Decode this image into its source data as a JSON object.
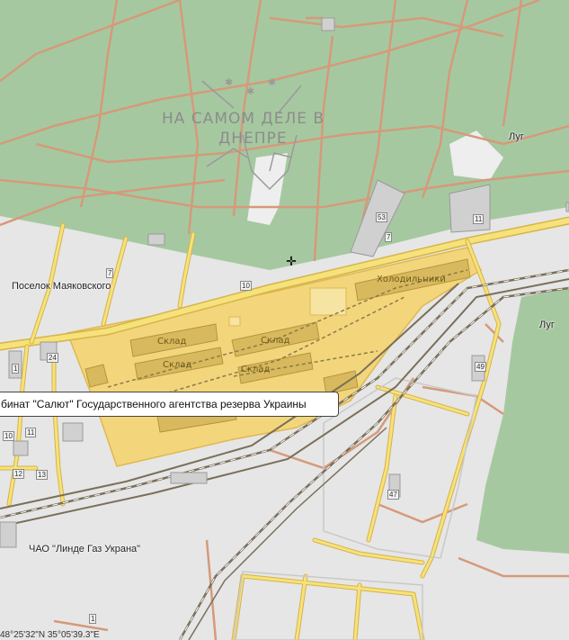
{
  "watermark": {
    "line1": "НА САМОМ ДЕЛЕ В",
    "line2": "ДНЕПРЕ"
  },
  "place_labels": {
    "poselok": "Поселок Маяковского",
    "lug_top": "Луг",
    "lug_right": "Луг",
    "linde": "ЧАО \"Линде Газ Украна\""
  },
  "buildings": {
    "holodilniki": "Холодильники",
    "sklad1": "Склад",
    "sklad2": "Склад",
    "sklad3": "Склад",
    "sklad4": "Склад"
  },
  "house_numbers": {
    "n7a": "7",
    "n10": "10",
    "n53": "53",
    "n7b": "7",
    "n11a": "11",
    "n49": "49",
    "n47": "47",
    "n1a": "1",
    "n24": "24",
    "n10b": "10",
    "n11b": "11",
    "n12": "12",
    "n13": "13",
    "n1b": "1"
  },
  "tooltip": {
    "text": "бинат \"Салют\" Государственного агентства резерва Украины"
  },
  "coordinates": "48°25'32\"N 35°05'39.3\"E",
  "colors": {
    "forest": "#a6c8a0",
    "background": "#e6e6e6",
    "industrial_zone": "#f3d67c",
    "major_road": "#f5e27a",
    "minor_road": "#d59a7a",
    "railway": "#7a6f5a"
  },
  "icons": {
    "cursor": "crosshair-cursor-icon"
  }
}
